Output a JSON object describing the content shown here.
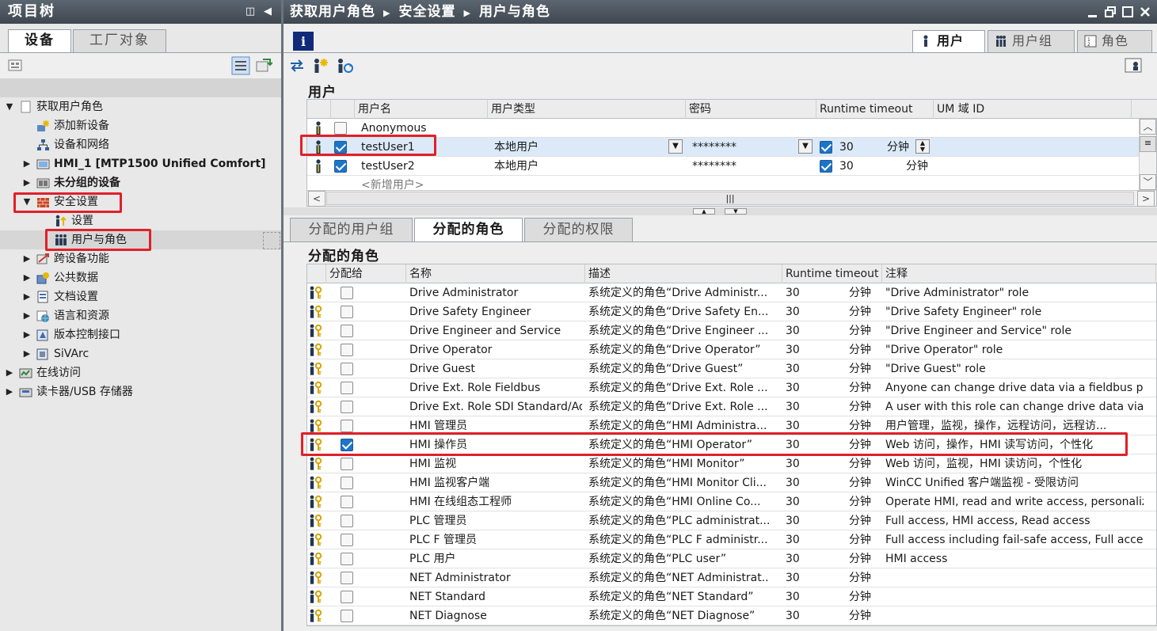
{
  "left_panel": {
    "title": "项目树",
    "tabs": [
      "设备",
      "工厂对象"
    ],
    "tree": [
      {
        "label": "获取用户角色",
        "arrow": "▼",
        "level": 0,
        "icon": "project-icon"
      },
      {
        "label": "添加新设备",
        "arrow": "",
        "level": 1,
        "icon": "add-device-icon"
      },
      {
        "label": "设备和网络",
        "arrow": "",
        "level": 1,
        "icon": "network-icon"
      },
      {
        "label": "HMI_1 [MTP1500 Unified Comfort]",
        "arrow": "▶",
        "level": 1,
        "icon": "hmi-icon",
        "bold": true
      },
      {
        "label": "未分组的设备",
        "arrow": "▶",
        "level": 1,
        "icon": "devices-icon",
        "bold": true
      },
      {
        "label": "安全设置",
        "arrow": "▼",
        "level": 1,
        "icon": "firewall-icon"
      },
      {
        "label": "设置",
        "arrow": "",
        "level": 2,
        "icon": "settings-user-icon"
      },
      {
        "label": "用户与角色",
        "arrow": "",
        "level": 2,
        "icon": "users-roles-icon",
        "selected": true
      },
      {
        "label": "跨设备功能",
        "arrow": "▶",
        "level": 1,
        "icon": "cross-device-icon"
      },
      {
        "label": "公共数据",
        "arrow": "▶",
        "level": 1,
        "icon": "common-data-icon"
      },
      {
        "label": "文档设置",
        "arrow": "▶",
        "level": 1,
        "icon": "doc-settings-icon"
      },
      {
        "label": "语言和资源",
        "arrow": "▶",
        "level": 1,
        "icon": "language-icon"
      },
      {
        "label": "版本控制接口",
        "arrow": "▶",
        "level": 1,
        "icon": "version-control-icon"
      },
      {
        "label": "SiVArc",
        "arrow": "▶",
        "level": 1,
        "icon": "sivarc-icon"
      },
      {
        "label": "在线访问",
        "arrow": "▶",
        "level": 0,
        "icon": "online-access-icon"
      },
      {
        "label": "读卡器/USB 存储器",
        "arrow": "▶",
        "level": 0,
        "icon": "card-reader-icon"
      }
    ]
  },
  "editor": {
    "breadcrumb": [
      "获取用户角色",
      "安全设置",
      "用户与角色"
    ],
    "tabs": [
      "用户",
      "用户组",
      "角色"
    ],
    "users_section": {
      "title": "用户",
      "columns": [
        "用户名",
        "用户类型",
        "密码",
        "Runtime timeout",
        "UM 域 ID"
      ],
      "rows": [
        {
          "name": "Anonymous",
          "type": "",
          "password": "",
          "timeout": "",
          "unit": "",
          "checked": false,
          "timeout_checked": null
        },
        {
          "name": "testUser1",
          "type": "本地用户",
          "password": "********",
          "timeout": "30",
          "unit": "分钟",
          "checked": true,
          "timeout_checked": true
        },
        {
          "name": "testUser2",
          "type": "本地用户",
          "password": "********",
          "timeout": "30",
          "unit": "分钟",
          "checked": true,
          "timeout_checked": true
        }
      ],
      "add_placeholder": "<新增用户>"
    },
    "bottom_tabs": [
      "分配的用户组",
      "分配的角色",
      "分配的权限"
    ],
    "roles_section": {
      "title": "分配的角色",
      "columns": [
        "分配给",
        "名称",
        "描述",
        "Runtime timeout",
        "注释"
      ],
      "rows": [
        {
          "assigned": false,
          "name": "Drive Administrator",
          "desc": "系统定义的角色“Drive Administr...",
          "timeout": "30",
          "unit": "分钟",
          "comment": "\"Drive Administrator\" role"
        },
        {
          "assigned": false,
          "name": "Drive Safety Engineer",
          "desc": "系统定义的角色“Drive Safety En...",
          "timeout": "30",
          "unit": "分钟",
          "comment": "\"Drive Safety Engineer\" role"
        },
        {
          "assigned": false,
          "name": "Drive Engineer and Service",
          "desc": "系统定义的角色“Drive Engineer ...",
          "timeout": "30",
          "unit": "分钟",
          "comment": "\"Drive Engineer and Service\" role"
        },
        {
          "assigned": false,
          "name": "Drive Operator",
          "desc": "系统定义的角色“Drive Operator”",
          "timeout": "30",
          "unit": "分钟",
          "comment": "\"Drive Operator\" role"
        },
        {
          "assigned": false,
          "name": "Drive Guest",
          "desc": "系统定义的角色“Drive Guest”",
          "timeout": "30",
          "unit": "分钟",
          "comment": "\"Drive Guest\" role"
        },
        {
          "assigned": false,
          "name": "Drive Ext. Role Fieldbus",
          "desc": "系统定义的角色“Drive Ext. Role ...",
          "timeout": "30",
          "unit": "分钟",
          "comment": "Anyone can change drive data via a fieldbus prot..."
        },
        {
          "assigned": false,
          "name": "Drive Ext. Role SDI Standard/Adv",
          "desc": "系统定义的角色“Drive Ext. Role ...",
          "timeout": "30",
          "unit": "分钟",
          "comment": "A user with this role can change drive data via S..."
        },
        {
          "assigned": false,
          "name": "HMI 管理员",
          "desc": "系统定义的角色“HMI Administra...",
          "timeout": "30",
          "unit": "分钟",
          "comment": "用户管理，监视，操作，远程访问，远程访..."
        },
        {
          "assigned": true,
          "name": "HMI 操作员",
          "desc": "系统定义的角色“HMI Operator”",
          "timeout": "30",
          "unit": "分钟",
          "comment": "Web 访问，操作，HMI 读写访问，个性化"
        },
        {
          "assigned": false,
          "name": "HMI 监视",
          "desc": "系统定义的角色“HMI Monitor”",
          "timeout": "30",
          "unit": "分钟",
          "comment": "Web 访问，监视，HMI 读访问，个性化"
        },
        {
          "assigned": false,
          "name": "HMI 监视客户端",
          "desc": "系统定义的角色“HMI Monitor Cli...",
          "timeout": "30",
          "unit": "分钟",
          "comment": "WinCC Unified 客户端监视 - 受限访问"
        },
        {
          "assigned": false,
          "name": "HMI 在线组态工程师",
          "desc": "系统定义的角色“HMI Online Co...",
          "timeout": "30",
          "unit": "分钟",
          "comment": "Operate HMI, read and write access, personalized"
        },
        {
          "assigned": false,
          "name": "PLC 管理员",
          "desc": "系统定义的角色“PLC administrat...",
          "timeout": "30",
          "unit": "分钟",
          "comment": "Full access, HMI access, Read access"
        },
        {
          "assigned": false,
          "name": "PLC F 管理员",
          "desc": "系统定义的角色“PLC F administr...",
          "timeout": "30",
          "unit": "分钟",
          "comment": "Full access including fail-safe access, Full access, ..."
        },
        {
          "assigned": false,
          "name": "PLC 用户",
          "desc": "系统定义的角色“PLC user”",
          "timeout": "30",
          "unit": "分钟",
          "comment": "HMI access"
        },
        {
          "assigned": false,
          "name": "NET Administrator",
          "desc": "系统定义的角色“NET Administrat...",
          "timeout": "30",
          "unit": "分钟",
          "comment": ""
        },
        {
          "assigned": false,
          "name": "NET Standard",
          "desc": "系统定义的角色“NET Standard”",
          "timeout": "30",
          "unit": "分钟",
          "comment": ""
        },
        {
          "assigned": false,
          "name": "NET Diagnose",
          "desc": "系统定义的角色“NET Diagnose”",
          "timeout": "30",
          "unit": "分钟",
          "comment": ""
        }
      ]
    }
  },
  "colors": {
    "title_bar": "#4a545d",
    "highlight_red": "#e0202a",
    "checkbox_blue": "#1e74c9",
    "selected_row": "#dbe9f8"
  }
}
